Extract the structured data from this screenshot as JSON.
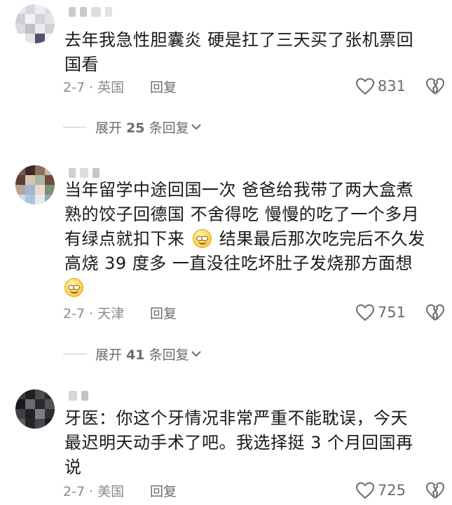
{
  "comments": [
    {
      "text_lines": [
        "去年我急性胆囊炎 硬是扛了三天买了张机票回",
        "国看"
      ],
      "date_location": "2-7 · 英国",
      "reply_label": "回复",
      "likes": "831",
      "replies": {
        "prefix": "展开",
        "count": "25",
        "suffix": "条回复"
      }
    },
    {
      "text_lines": [
        "当年留学中途回国一次 爸爸给我带了两大盒煮",
        "熟的饺子回德国 不舍得吃 慢慢的吃了一个多月",
        "有绿点就扣下来",
        "结果最后那次吃完后不久发",
        "高烧 39 度多 一直没往吃坏肚子发烧那方面想"
      ],
      "date_location": "2-7 · 天津",
      "reply_label": "回复",
      "likes": "751",
      "replies": {
        "prefix": "展开",
        "count": "41",
        "suffix": "条回复"
      }
    },
    {
      "text_lines": [
        "牙医：你这个牙情况非常严重不能耽误，今天",
        "最迟明天动手术了吧。我选择挺 3 个月回国再",
        "说"
      ],
      "date_location": "2-7 · 美国",
      "reply_label": "回复",
      "likes": "725"
    }
  ],
  "icons": {
    "like": "heart-outline-icon",
    "dislike": "broken-heart-icon",
    "expand": "chevron-down-icon",
    "emoji": "grinning-face-emoji"
  },
  "colors": {
    "text": "#1a1a1a",
    "meta": "#8a8b91",
    "action": "#6b6c72",
    "emoji": "#fbd75b"
  }
}
